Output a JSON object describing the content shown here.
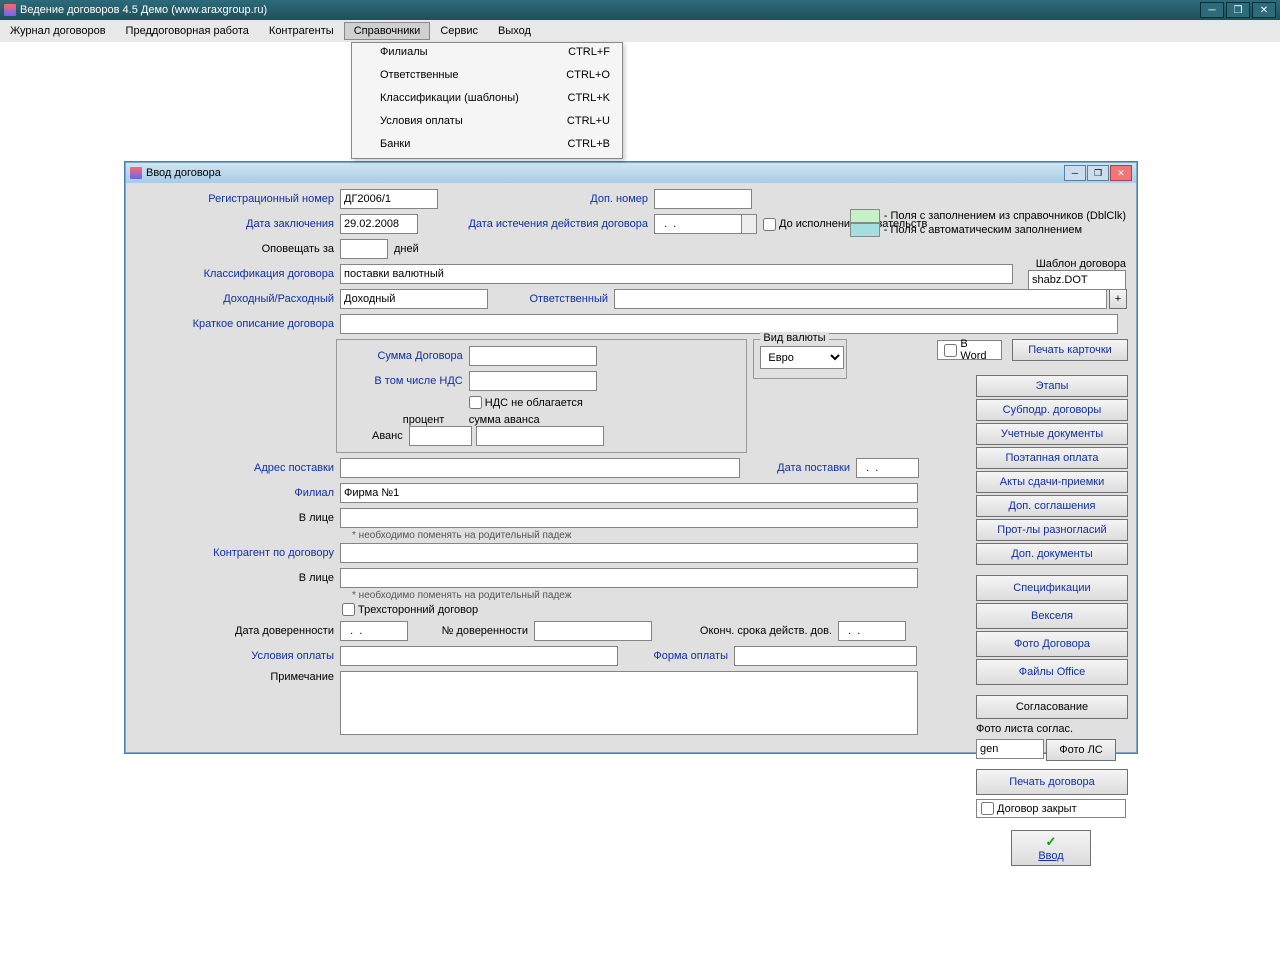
{
  "app": {
    "title": "Ведение договоров 4.5 Демо (www.araxgroup.ru)"
  },
  "menu": {
    "items": [
      "Журнал договоров",
      "Преддоговорная работа",
      "Контрагенты",
      "Справочники",
      "Сервис",
      "Выход"
    ],
    "openIndex": 3,
    "dropdown": [
      {
        "label": "Филиалы",
        "accel": "CTRL+F"
      },
      {
        "label": "Ответственные",
        "accel": "CTRL+O"
      },
      {
        "label": "Классификации (шаблоны)",
        "accel": "CTRL+K"
      },
      {
        "label": "Условия оплаты",
        "accel": "CTRL+U"
      },
      {
        "label": "Банки",
        "accel": "CTRL+B"
      }
    ]
  },
  "dialog": {
    "title": "Ввод договора",
    "labels": {
      "reg_number": "Регистрационный номер",
      "dop_number": "Доп. номер",
      "date_conclusion": "Дата заключения",
      "date_expiry": "Дата истечения действия договора",
      "until_obligations": "До исполнения обязательств",
      "notify_in": "Оповещать за",
      "days": "дней",
      "template": "Шаблон договора",
      "classification": "Классификация договора",
      "income_expense": "Доходный/Расходный",
      "responsible": "Ответственный",
      "short_desc": "Краткое описание договора",
      "contract_sum": "Сумма Договора",
      "including_vat": "В том числе НДС",
      "vat_exempt": "НДС не облагается",
      "advance": "Аванс",
      "percent": "процент",
      "advance_sum": "сумма аванса",
      "currency": "Вид валюты",
      "in_word": "В Word",
      "print_card": "Печать карточки",
      "delivery_address": "Адрес поставки",
      "delivery_date": "Дата поставки",
      "branch": "Филиал",
      "in_person": "В лице",
      "hint_genitive": "* необходимо поменять на родительный падеж",
      "counterparty": "Контрагент по договору",
      "trilateral": "Трехсторонний договор",
      "attorney_date": "Дата доверенности",
      "attorney_number": "№ доверенности",
      "attorney_expiry": "Оконч. срока действ. дов.",
      "payment_terms": "Условия оплаты",
      "payment_form": "Форма оплаты",
      "notes": "Примечание",
      "photo_sheet": "Фото листа соглас.",
      "contract_closed": "Договор закрыт",
      "enter": "Ввод",
      "legend1": "- Поля с заполнением из справочников (DblClk)",
      "legend2": "- Поля с автоматическим заполнением"
    },
    "values": {
      "reg_number": "ДГ2006/1",
      "dop_number": "",
      "date_conclusion": "29.02.2008",
      "date_expiry": "  .  .    ",
      "notify_in": "",
      "template": "shabz.DOT",
      "classification": "поставки валютный",
      "income_expense": "Доходный",
      "responsible": "",
      "short_desc": "",
      "contract_sum": "",
      "including_vat": "",
      "advance_percent": "",
      "advance_sum": "",
      "currency": "Евро",
      "delivery_address": "",
      "delivery_date": "  .  .    ",
      "branch": "Фирма №1",
      "in_person1": "",
      "counterparty": "",
      "in_person2": "",
      "attorney_date": "  .  .    ",
      "attorney_number": "",
      "attorney_expiry": "  .  .    ",
      "payment_terms": "",
      "payment_form": "",
      "notes": "",
      "photo_gen": "gen"
    },
    "buttons": {
      "stages": "Этапы",
      "subcontracts": "Субподр. договоры",
      "accounting": "Учетные документы",
      "staged_payment": "Поэтапная оплата",
      "acceptance": "Акты сдачи-приемки",
      "addendum": "Доп. соглашения",
      "protocols": "Прот-лы разногласий",
      "add_docs": "Доп. документы",
      "specs": "Спецификации",
      "bills": "Векселя",
      "photo_contract": "Фото Договора",
      "office_files": "Файлы Office",
      "approval": "Согласование",
      "photo_ls": "Фото ЛС",
      "print_contract": "Печать договора"
    }
  }
}
